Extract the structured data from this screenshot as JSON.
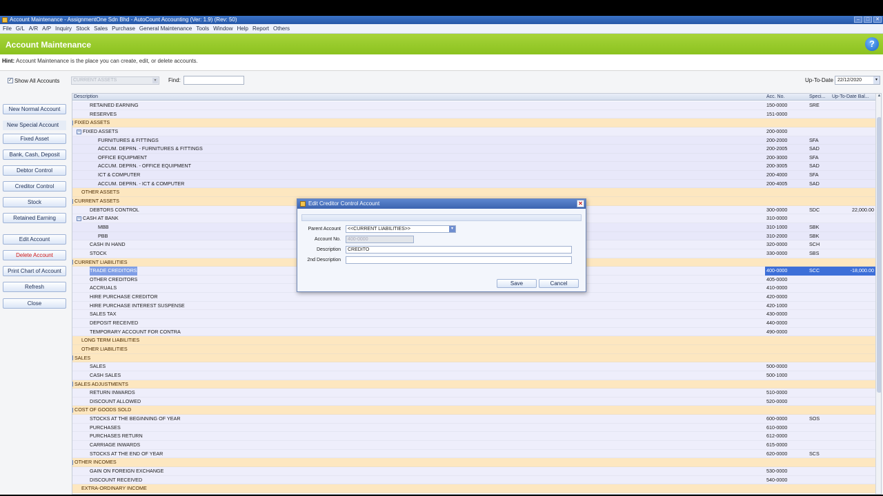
{
  "window": {
    "title": "Account Maintenance - AssignmentOne Sdn Bhd - AutoCount Accounting (Ver: 1.9) (Rev: 50)",
    "buttons": [
      "–",
      "□",
      "✕"
    ]
  },
  "menu": [
    "File",
    "G/L",
    "A/R",
    "A/P",
    "Inquiry",
    "Stock",
    "Sales",
    "Purchase",
    "General Maintenance",
    "Tools",
    "Window",
    "Help",
    "Report",
    "Others"
  ],
  "header": {
    "title": "Account Maintenance",
    "help": "?"
  },
  "hint": {
    "label": "Hint:",
    "text": "Account Maintenance is the place you can create, edit, or delete accounts."
  },
  "filter": {
    "show_all_label": "Show All Accounts",
    "show_all_checked": "✓",
    "category_value": "CURRENT ASSETS",
    "find_label": "Find:",
    "find_value": "",
    "upto_label": "Up-To-Date",
    "upto_value": "22/12/2020"
  },
  "left_buttons": {
    "new_normal": "New Normal Account",
    "new_special_label": "New Special Account",
    "fixed_asset": "Fixed Asset",
    "bank_cash": "Bank, Cash, Deposit",
    "debtor_control": "Debtor Control",
    "creditor_control": "Creditor Control",
    "stock": "Stock",
    "retained_earning": "Retained Earning",
    "edit_account": "Edit Account",
    "delete_account": "Delete Account",
    "print_chart": "Print Chart of Account",
    "refresh": "Refresh",
    "close": "Close"
  },
  "grid": {
    "columns": {
      "description": "Description",
      "acc_no": "Acc. No.",
      "special": "Speci...",
      "balance": "Up-To-Date Bal..."
    },
    "rows": [
      {
        "desc": "RETAINED EARNING",
        "acc": "150-0000",
        "sp": "SRE",
        "bal": "",
        "level": 1,
        "tog": "",
        "cls": "l1"
      },
      {
        "desc": "RESERVES",
        "acc": "151-0000",
        "sp": "",
        "bal": "",
        "level": 1,
        "tog": "",
        "cls": "l1"
      },
      {
        "desc": "FIXED ASSETS",
        "acc": "",
        "sp": "",
        "bal": "",
        "level": 0,
        "tog": "−",
        "cls": "group"
      },
      {
        "desc": "FIXED ASSETS",
        "acc": "200-0000",
        "sp": "",
        "bal": "",
        "level": 1,
        "tog": "−",
        "cls": "l1"
      },
      {
        "desc": "FURNITURES & FITTINGS",
        "acc": "200-2000",
        "sp": "SFA",
        "bal": "",
        "level": 2,
        "tog": "",
        "cls": "l2"
      },
      {
        "desc": "ACCUM. DEPRN. - FURNITURES & FITTINGS",
        "acc": "200-2005",
        "sp": "SAD",
        "bal": "",
        "level": 2,
        "tog": "",
        "cls": "l2"
      },
      {
        "desc": "OFFICE EQUIPMENT",
        "acc": "200-3000",
        "sp": "SFA",
        "bal": "",
        "level": 2,
        "tog": "",
        "cls": "l2"
      },
      {
        "desc": "ACCUM. DEPRN. - OFFICE EQUIPMENT",
        "acc": "200-3005",
        "sp": "SAD",
        "bal": "",
        "level": 2,
        "tog": "",
        "cls": "l2"
      },
      {
        "desc": "ICT & COMPUTER",
        "acc": "200-4000",
        "sp": "SFA",
        "bal": "",
        "level": 2,
        "tog": "",
        "cls": "l2"
      },
      {
        "desc": "ACCUM. DEPRN. - ICT & COMPUTER",
        "acc": "200-4005",
        "sp": "SAD",
        "bal": "",
        "level": 2,
        "tog": "",
        "cls": "l2"
      },
      {
        "desc": "OTHER ASSETS",
        "acc": "",
        "sp": "",
        "bal": "",
        "level": 0,
        "tog": "",
        "cls": "group"
      },
      {
        "desc": "CURRENT ASSETS",
        "acc": "",
        "sp": "",
        "bal": "",
        "level": 0,
        "tog": "−",
        "cls": "group"
      },
      {
        "desc": "DEBTORS CONTROL",
        "acc": "300-0000",
        "sp": "SDC",
        "bal": "22,000.00",
        "level": 1,
        "tog": "",
        "cls": "l1"
      },
      {
        "desc": "CASH AT BANK",
        "acc": "310-0000",
        "sp": "",
        "bal": "",
        "level": 1,
        "tog": "−",
        "cls": "l1"
      },
      {
        "desc": "MBB",
        "acc": "310-1000",
        "sp": "SBK",
        "bal": "",
        "level": 2,
        "tog": "",
        "cls": "l2"
      },
      {
        "desc": "PBB",
        "acc": "310-2000",
        "sp": "SBK",
        "bal": "",
        "level": 2,
        "tog": "",
        "cls": "l2"
      },
      {
        "desc": "CASH IN HAND",
        "acc": "320-0000",
        "sp": "SCH",
        "bal": "",
        "level": 1,
        "tog": "",
        "cls": "l1"
      },
      {
        "desc": "STOCK",
        "acc": "330-0000",
        "sp": "SBS",
        "bal": "",
        "level": 1,
        "tog": "",
        "cls": "l1"
      },
      {
        "desc": "CURRENT LIABILITIES",
        "acc": "",
        "sp": "",
        "bal": "",
        "level": 0,
        "tog": "−",
        "cls": "group"
      },
      {
        "desc": "TRADE CREDITORS",
        "acc": "400-0000",
        "sp": "SCC",
        "bal": "-18,000.00",
        "level": 1,
        "tog": "",
        "cls": "l1 sel"
      },
      {
        "desc": "OTHER CREDITORS",
        "acc": "405-0000",
        "sp": "",
        "bal": "",
        "level": 1,
        "tog": "",
        "cls": "l1"
      },
      {
        "desc": "ACCRUALS",
        "acc": "410-0000",
        "sp": "",
        "bal": "",
        "level": 1,
        "tog": "",
        "cls": "l1"
      },
      {
        "desc": "HIRE PURCHASE CREDITOR",
        "acc": "420-0000",
        "sp": "",
        "bal": "",
        "level": 1,
        "tog": "",
        "cls": "l1"
      },
      {
        "desc": "HIRE PURCHASE INTEREST SUSPENSE",
        "acc": "420-1000",
        "sp": "",
        "bal": "",
        "level": 1,
        "tog": "",
        "cls": "l1"
      },
      {
        "desc": "SALES TAX",
        "acc": "430-0000",
        "sp": "",
        "bal": "",
        "level": 1,
        "tog": "",
        "cls": "l1"
      },
      {
        "desc": "DEPOSIT RECEIVED",
        "acc": "440-0000",
        "sp": "",
        "bal": "",
        "level": 1,
        "tog": "",
        "cls": "l1"
      },
      {
        "desc": "TEMPORARY ACCOUNT FOR CONTRA",
        "acc": "490-0000",
        "sp": "",
        "bal": "",
        "level": 1,
        "tog": "",
        "cls": "l1"
      },
      {
        "desc": "LONG TERM LIABILITIES",
        "acc": "",
        "sp": "",
        "bal": "",
        "level": 0,
        "tog": "",
        "cls": "group"
      },
      {
        "desc": "OTHER LIABILITIES",
        "acc": "",
        "sp": "",
        "bal": "",
        "level": 0,
        "tog": "",
        "cls": "group"
      },
      {
        "desc": "SALES",
        "acc": "",
        "sp": "",
        "bal": "",
        "level": 0,
        "tog": "−",
        "cls": "group"
      },
      {
        "desc": "SALES",
        "acc": "500-0000",
        "sp": "",
        "bal": "",
        "level": 1,
        "tog": "",
        "cls": "l1"
      },
      {
        "desc": "CASH SALES",
        "acc": "500-1000",
        "sp": "",
        "bal": "",
        "level": 1,
        "tog": "",
        "cls": "l1"
      },
      {
        "desc": "SALES ADJUSTMENTS",
        "acc": "",
        "sp": "",
        "bal": "",
        "level": 0,
        "tog": "−",
        "cls": "group"
      },
      {
        "desc": "RETURN INWARDS",
        "acc": "510-0000",
        "sp": "",
        "bal": "",
        "level": 1,
        "tog": "",
        "cls": "l1"
      },
      {
        "desc": "DISCOUNT ALLOWED",
        "acc": "520-0000",
        "sp": "",
        "bal": "",
        "level": 1,
        "tog": "",
        "cls": "l1"
      },
      {
        "desc": "COST OF GOODS SOLD",
        "acc": "",
        "sp": "",
        "bal": "",
        "level": 0,
        "tog": "−",
        "cls": "group"
      },
      {
        "desc": "STOCKS AT THE BEGINNING OF YEAR",
        "acc": "600-0000",
        "sp": "SOS",
        "bal": "",
        "level": 1,
        "tog": "",
        "cls": "l1"
      },
      {
        "desc": "PURCHASES",
        "acc": "610-0000",
        "sp": "",
        "bal": "",
        "level": 1,
        "tog": "",
        "cls": "l1"
      },
      {
        "desc": "PURCHASES RETURN",
        "acc": "612-0000",
        "sp": "",
        "bal": "",
        "level": 1,
        "tog": "",
        "cls": "l1"
      },
      {
        "desc": "CARRIAGE INWARDS",
        "acc": "615-0000",
        "sp": "",
        "bal": "",
        "level": 1,
        "tog": "",
        "cls": "l1"
      },
      {
        "desc": "STOCKS AT THE END OF YEAR",
        "acc": "620-0000",
        "sp": "SCS",
        "bal": "",
        "level": 1,
        "tog": "",
        "cls": "l1"
      },
      {
        "desc": "OTHER INCOMES",
        "acc": "",
        "sp": "",
        "bal": "",
        "level": 0,
        "tog": "−",
        "cls": "group"
      },
      {
        "desc": "GAIN ON FOREIGN EXCHANGE",
        "acc": "530-0000",
        "sp": "",
        "bal": "",
        "level": 1,
        "tog": "",
        "cls": "l1"
      },
      {
        "desc": "DISCOUNT RECEIVED",
        "acc": "540-0000",
        "sp": "",
        "bal": "",
        "level": 1,
        "tog": "",
        "cls": "l1"
      },
      {
        "desc": "EXTRA-ORDINARY INCOME",
        "acc": "",
        "sp": "",
        "bal": "",
        "level": 0,
        "tog": "",
        "cls": "group"
      }
    ]
  },
  "dialog": {
    "title": "Edit Creditor Control Account",
    "close": "✕",
    "parent_label": "Parent Account",
    "parent_value": "<<CURRENT LIABILITIES>>",
    "accno_label": "Account No.",
    "accno_value": "400-0000",
    "desc_label": "Description",
    "desc_value": "CREDITO",
    "desc2_label": "2nd Description",
    "desc2_value": "",
    "save": "Save",
    "cancel": "Cancel"
  }
}
